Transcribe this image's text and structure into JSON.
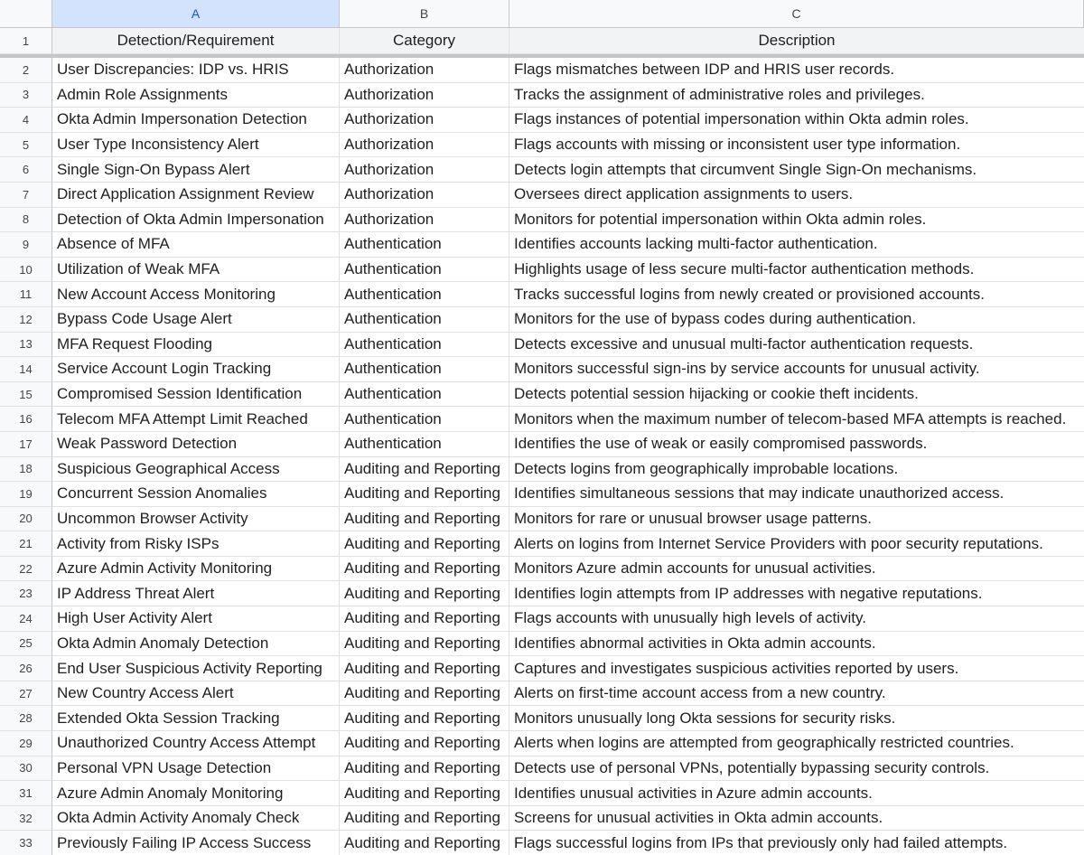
{
  "columns": [
    "A",
    "B",
    "C"
  ],
  "header": {
    "row_number": "1",
    "detection": "Detection/Requirement",
    "category": "Category",
    "description": "Description"
  },
  "rows": [
    {
      "n": "2",
      "a": "User Discrepancies: IDP vs. HRIS",
      "b": "Authorization",
      "c": "Flags mismatches between IDP and HRIS user records."
    },
    {
      "n": "3",
      "a": "Admin Role Assignments",
      "b": "Authorization",
      "c": "Tracks the assignment of administrative roles and privileges."
    },
    {
      "n": "4",
      "a": "Okta Admin Impersonation Detection",
      "b": "Authorization",
      "c": "Flags instances of potential impersonation within Okta admin roles."
    },
    {
      "n": "5",
      "a": "User Type Inconsistency Alert",
      "b": "Authorization",
      "c": "Flags accounts with missing or inconsistent user type information."
    },
    {
      "n": "6",
      "a": "Single Sign-On Bypass Alert",
      "b": "Authorization",
      "c": "Detects login attempts that circumvent Single Sign-On mechanisms."
    },
    {
      "n": "7",
      "a": "Direct Application Assignment Review",
      "b": "Authorization",
      "c": "Oversees direct application assignments to users."
    },
    {
      "n": "8",
      "a": "Detection of Okta Admin Impersonation",
      "b": "Authorization",
      "c": "Monitors for potential impersonation within Okta admin roles."
    },
    {
      "n": "9",
      "a": "Absence of MFA",
      "b": "Authentication",
      "c": "Identifies accounts lacking multi-factor authentication."
    },
    {
      "n": "10",
      "a": "Utilization of Weak MFA",
      "b": "Authentication",
      "c": "Highlights usage of less secure multi-factor authentication methods."
    },
    {
      "n": "11",
      "a": "New Account Access Monitoring",
      "b": "Authentication",
      "c": "Tracks successful logins from newly created or provisioned accounts."
    },
    {
      "n": "12",
      "a": "Bypass Code Usage Alert",
      "b": "Authentication",
      "c": "Monitors for the use of bypass codes during authentication."
    },
    {
      "n": "13",
      "a": "MFA Request Flooding",
      "b": "Authentication",
      "c": "Detects excessive and unusual multi-factor authentication requests."
    },
    {
      "n": "14",
      "a": "Service Account Login Tracking",
      "b": "Authentication",
      "c": "Monitors successful sign-ins by service accounts for unusual activity."
    },
    {
      "n": "15",
      "a": "Compromised Session Identification",
      "b": "Authentication",
      "c": "Detects potential session hijacking or cookie theft incidents."
    },
    {
      "n": "16",
      "a": "Telecom MFA Attempt Limit Reached",
      "b": "Authentication",
      "c": "Monitors when the maximum number of telecom-based MFA attempts is reached."
    },
    {
      "n": "17",
      "a": "Weak Password Detection",
      "b": "Authentication",
      "c": "Identifies the use of weak or easily compromised passwords."
    },
    {
      "n": "18",
      "a": "Suspicious Geographical Access",
      "b": "Auditing and Reporting",
      "c": "Detects logins from geographically improbable locations."
    },
    {
      "n": "19",
      "a": "Concurrent Session Anomalies",
      "b": "Auditing and Reporting",
      "c": "Identifies simultaneous sessions that may indicate unauthorized access."
    },
    {
      "n": "20",
      "a": "Uncommon Browser Activity",
      "b": "Auditing and Reporting",
      "c": "Monitors for rare or unusual browser usage patterns."
    },
    {
      "n": "21",
      "a": "Activity from Risky ISPs",
      "b": "Auditing and Reporting",
      "c": "Alerts on logins from Internet Service Providers with poor security reputations."
    },
    {
      "n": "22",
      "a": "Azure Admin Activity Monitoring",
      "b": "Auditing and Reporting",
      "c": "Monitors Azure admin accounts for unusual activities."
    },
    {
      "n": "23",
      "a": "IP Address Threat Alert",
      "b": "Auditing and Reporting",
      "c": "Identifies login attempts from IP addresses with negative reputations."
    },
    {
      "n": "24",
      "a": "High User Activity Alert",
      "b": "Auditing and Reporting",
      "c": "Flags accounts with unusually high levels of activity."
    },
    {
      "n": "25",
      "a": "Okta Admin Anomaly Detection",
      "b": "Auditing and Reporting",
      "c": "Identifies abnormal activities in Okta admin accounts."
    },
    {
      "n": "26",
      "a": "End User Suspicious Activity Reporting",
      "b": "Auditing and Reporting",
      "c": "Captures and investigates suspicious activities reported by users."
    },
    {
      "n": "27",
      "a": "New Country Access Alert",
      "b": "Auditing and Reporting",
      "c": "Alerts on first-time account access from a new country."
    },
    {
      "n": "28",
      "a": "Extended Okta Session Tracking",
      "b": "Auditing and Reporting",
      "c": "Monitors unusually long Okta sessions for security risks."
    },
    {
      "n": "29",
      "a": "Unauthorized Country Access Attempt",
      "b": "Auditing and Reporting",
      "c": "Alerts when logins are attempted from geographically restricted countries."
    },
    {
      "n": "30",
      "a": "Personal VPN Usage Detection",
      "b": "Auditing and Reporting",
      "c": "Detects use of personal VPNs, potentially bypassing security controls."
    },
    {
      "n": "31",
      "a": "Azure Admin Anomaly Monitoring",
      "b": "Auditing and Reporting",
      "c": "Identifies unusual activities in Azure admin accounts."
    },
    {
      "n": "32",
      "a": "Okta Admin Activity Anomaly Check",
      "b": "Auditing and Reporting",
      "c": "Screens for unusual activities in Okta admin accounts."
    },
    {
      "n": "33",
      "a": "Previously Failing IP Access Success",
      "b": "Auditing and Reporting",
      "c": "Flags successful logins from IPs that previously only had failed attempts."
    }
  ]
}
